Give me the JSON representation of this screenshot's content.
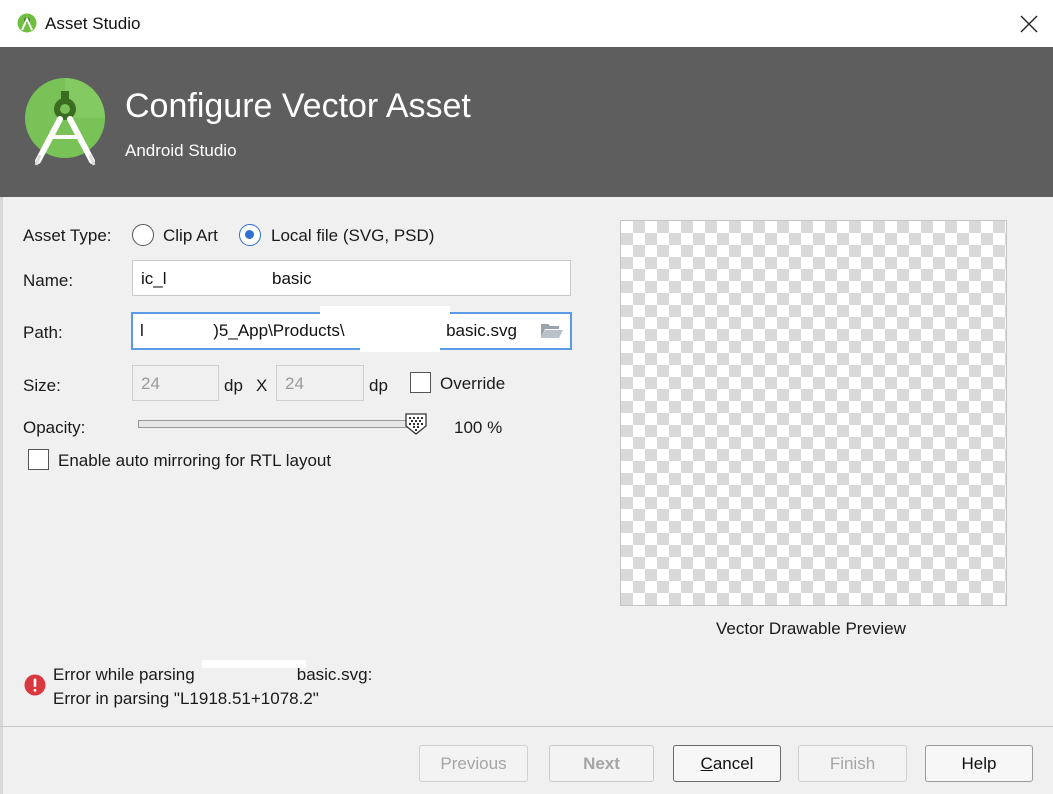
{
  "window": {
    "title": "Asset Studio",
    "close_icon": "close-icon"
  },
  "banner": {
    "title": "Configure Vector Asset",
    "subtitle": "Android Studio",
    "logo_icon": "android-studio-logo-icon"
  },
  "form": {
    "asset_type_label": "Asset Type:",
    "asset_type_options": [
      {
        "label": "Clip Art",
        "selected": false
      },
      {
        "label": "Local file (SVG, PSD)",
        "selected": true
      }
    ],
    "name_label": "Name:",
    "name_value_prefix": "ic_l",
    "name_value_suffix": "basic",
    "path_label": "Path:",
    "path_value_start": "l",
    "path_value_middle": ")5_App\\Products\\",
    "path_value_end": "basic.svg",
    "path_browse_icon": "folder-open-icon",
    "size_label": "Size:",
    "size_width": "24",
    "size_height": "24",
    "size_unit": "dp",
    "size_separator": "X",
    "override_label": "Override",
    "override_checked": false,
    "opacity_label": "Opacity:",
    "opacity_value": 100,
    "opacity_display": "100 %",
    "auto_mirror_label": "Enable auto mirroring for RTL layout",
    "auto_mirror_checked": false
  },
  "preview": {
    "caption": "Vector Drawable Preview"
  },
  "error": {
    "icon": "error-icon",
    "color": "#d9383f",
    "line1_prefix": "Error while parsing",
    "line1_suffix": "basic.svg:",
    "line2": "Error in parsing \"L1918.51+1078.2\""
  },
  "footer": {
    "previous_label": "Previous",
    "next_label": "Next",
    "cancel_mnemonic": "C",
    "cancel_rest": "ancel",
    "finish_label": "Finish",
    "help_label": "Help"
  },
  "colors": {
    "banner_bg": "#5e5e5e",
    "accent": "#2e6fd2",
    "focus_border": "#5b9ae5"
  }
}
